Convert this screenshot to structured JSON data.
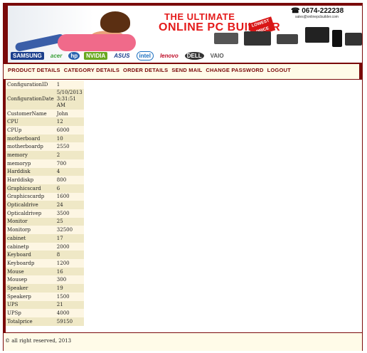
{
  "banner": {
    "title_line1": "THE ULTIMATE",
    "title_line2": "ONLINE PC BUILDER",
    "phone": "0674-222238",
    "email": "sales@onlinepcbuilder.com",
    "badge": "LOWEST PRICE",
    "brands": [
      "SAMSUNG",
      "acer",
      "hp",
      "NVIDIA",
      "ASUS",
      "intel",
      "lenovo",
      "DELL",
      "VAIO"
    ]
  },
  "nav": {
    "items": [
      "PRODUCT DETAILS",
      "CATEGORY DETAILS",
      "ORDER DETAILS",
      "SEND MAIL",
      "CHANGE PASSWORD",
      "LOGOUT"
    ]
  },
  "details": {
    "rows": [
      {
        "key": "ConfigurationID",
        "value": "1"
      },
      {
        "key": "ConfigurationDate",
        "value": "5/10/2013 3:31:51 AM"
      },
      {
        "key": "CustomerName",
        "value": "John"
      },
      {
        "key": "CPU",
        "value": "12"
      },
      {
        "key": "CPUp",
        "value": "6000"
      },
      {
        "key": "motherboard",
        "value": "10"
      },
      {
        "key": "motherboardp",
        "value": "2550"
      },
      {
        "key": "memory",
        "value": "2"
      },
      {
        "key": "memoryp",
        "value": "700"
      },
      {
        "key": "Harddisk",
        "value": "4"
      },
      {
        "key": "Harddiskp",
        "value": "800"
      },
      {
        "key": "Graphicscard",
        "value": "6"
      },
      {
        "key": "Graphicscardp",
        "value": "1600"
      },
      {
        "key": "Opticaldrive",
        "value": "24"
      },
      {
        "key": "Opticaldrivep",
        "value": "3500"
      },
      {
        "key": "Monitor",
        "value": "25"
      },
      {
        "key": "Monitorp",
        "value": "32500"
      },
      {
        "key": "cabinet",
        "value": "17"
      },
      {
        "key": "cabinetp",
        "value": "2000"
      },
      {
        "key": "Keyboard",
        "value": "8"
      },
      {
        "key": "Keyboardp",
        "value": "1200"
      },
      {
        "key": "Mouse",
        "value": "16"
      },
      {
        "key": "Mousep",
        "value": "300"
      },
      {
        "key": "Speaker",
        "value": "19"
      },
      {
        "key": "Speakerp",
        "value": "1500"
      },
      {
        "key": "UPS",
        "value": "21"
      },
      {
        "key": "UPSp",
        "value": "4000"
      },
      {
        "key": "Totalprice",
        "value": "59150"
      }
    ]
  },
  "footer": {
    "text": "© all right reserved, 2013"
  },
  "colors": {
    "maroon": "#7a0a0a",
    "cream": "#fffbe8",
    "row_light": "#fdf6e3",
    "row_dark": "#efe8c6",
    "title_red": "#e41b1b"
  }
}
